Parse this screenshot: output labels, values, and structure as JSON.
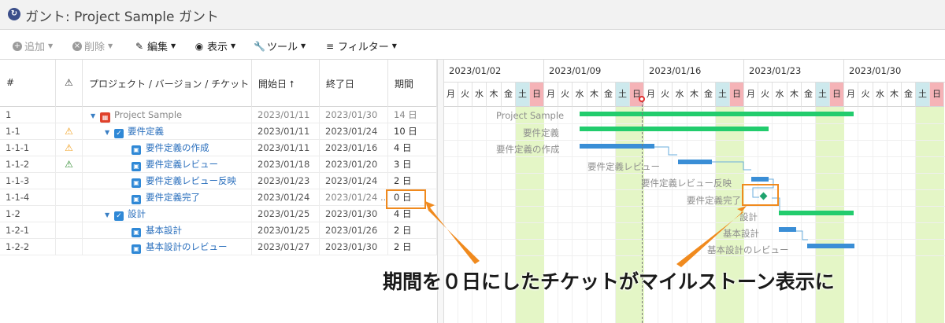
{
  "title": "ガント:  Project Sample ガント",
  "toolbar": {
    "add": "追加",
    "delete": "削除",
    "edit": "編集",
    "view": "表示",
    "tools": "ツール",
    "filter": "フィルター"
  },
  "columns": {
    "id": "#",
    "warn": "⚠",
    "name": "プロジェクト / バージョン / チケット",
    "start": "開始日 ⭡",
    "end": "終了日",
    "duration": "期間"
  },
  "rows": [
    {
      "id": "1",
      "warn": "",
      "name": "Project Sample",
      "start": "2023/01/11",
      "end": "2023/01/30",
      "duration": "14 日"
    },
    {
      "id": "1-1",
      "warn": "⚠",
      "name": "要件定義",
      "start": "2023/01/11",
      "end": "2023/01/24",
      "duration": "10 日"
    },
    {
      "id": "1-1-1",
      "warn": "⚠",
      "name": "要件定義の作成",
      "start": "2023/01/11",
      "end": "2023/01/16",
      "duration": "4 日"
    },
    {
      "id": "1-1-2",
      "warn": "⚠",
      "name": "要件定義レビュー",
      "start": "2023/01/18",
      "end": "2023/01/20",
      "duration": "3 日"
    },
    {
      "id": "1-1-3",
      "warn": "",
      "name": "要件定義レビュー反映",
      "start": "2023/01/23",
      "end": "2023/01/24",
      "duration": "2 日"
    },
    {
      "id": "1-1-4",
      "warn": "",
      "name": "要件定義完了",
      "start": "2023/01/24",
      "end": "2023/01/24 ...",
      "duration": "0 日"
    },
    {
      "id": "1-2",
      "warn": "",
      "name": "設計",
      "start": "2023/01/25",
      "end": "2023/01/30",
      "duration": "4 日"
    },
    {
      "id": "1-2-1",
      "warn": "",
      "name": "基本設計",
      "start": "2023/01/25",
      "end": "2023/01/26",
      "duration": "2 日"
    },
    {
      "id": "1-2-2",
      "warn": "",
      "name": "基本設計のレビュー",
      "start": "2023/01/27",
      "end": "2023/01/30",
      "duration": "2 日"
    }
  ],
  "gantt": {
    "weeks": [
      "2023/01/02",
      "2023/01/09",
      "2023/01/16",
      "2023/01/23",
      "2023/01/30"
    ],
    "weekdays": [
      "月",
      "火",
      "水",
      "木",
      "金",
      "土",
      "日"
    ],
    "labels": {
      "r0": "Project Sample",
      "r1": "要件定義",
      "r2": "要件定義の作成",
      "r3": "要件定義レビュー",
      "r4": "要件定義レビュー反映",
      "r5": "要件定義完了",
      "r6": "設計",
      "r7": "基本設計",
      "r8": "基本設計のレビュー"
    }
  },
  "annotation": "期間を０日にしたチケットがマイルストーン表示に",
  "colors": {
    "project_bar": "#22cc6d",
    "ticket_bar": "#3a8ed6",
    "weekend": "#e4f6c6",
    "highlight": "#f08a1e"
  }
}
